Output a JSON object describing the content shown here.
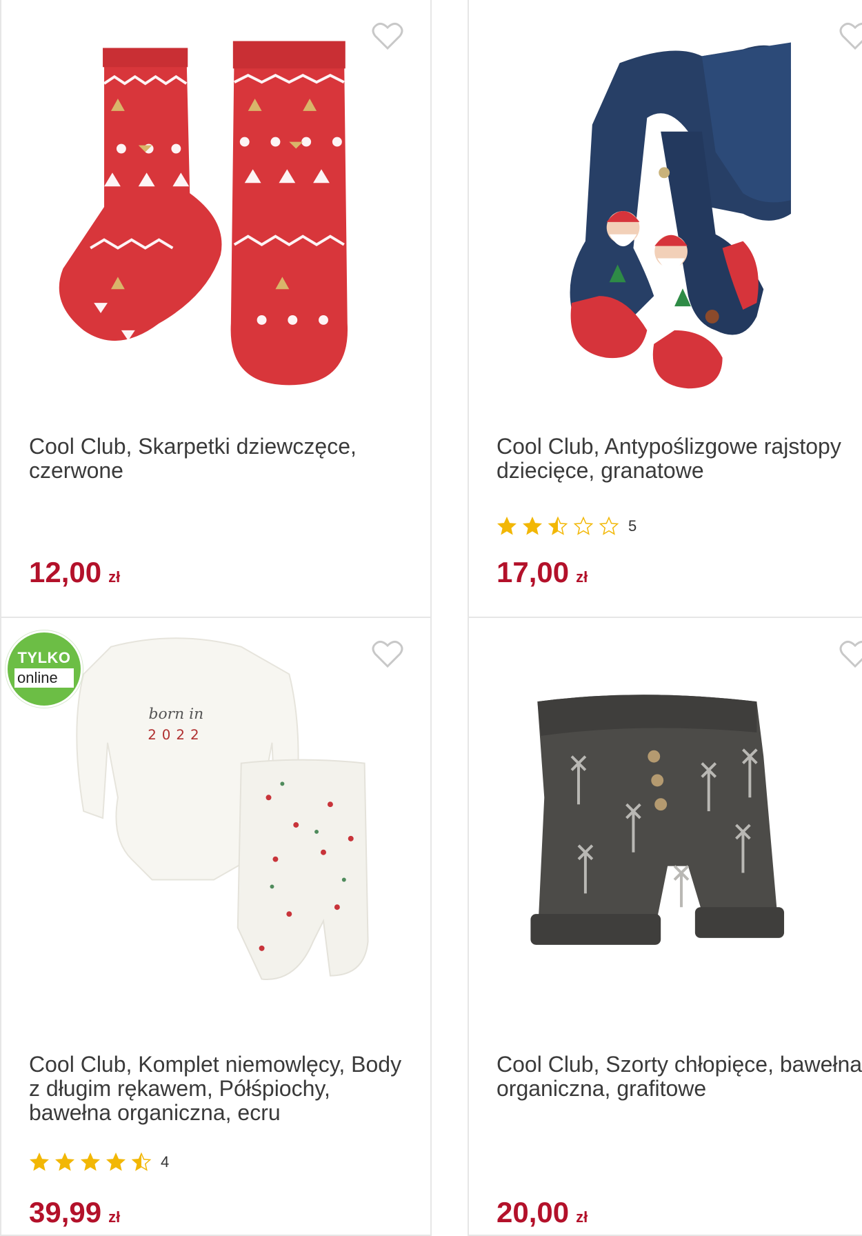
{
  "products": [
    {
      "title": "Cool Club, Skarpetki dziewczęce, czerwone",
      "price": "12,00",
      "currency": "zł",
      "rating": null,
      "review_count": null,
      "badge": null,
      "image": "red-christmas-socks"
    },
    {
      "title": "Cool Club, Antypoślizgowe rajstopy dziecięce, granatowe",
      "price": "17,00",
      "currency": "zł",
      "rating": 2.5,
      "review_count": "5",
      "badge": null,
      "image": "navy-santa-tights"
    },
    {
      "title": "Cool Club, Komplet niemowlęcy, Body z długim rękawem, Półśpiochy, bawełna organiczna, ecru",
      "price": "39,99",
      "currency": "zł",
      "rating": 4.5,
      "review_count": "4",
      "badge": {
        "line1": "TYLKO",
        "line2": "online"
      },
      "image": "ecru-baby-bodysuit-set",
      "image_text": {
        "script": "born in",
        "year": "2022"
      }
    },
    {
      "title": "Cool Club, Szorty chłopięce, bawełna organiczna, grafitowe",
      "price": "20,00",
      "currency": "zł",
      "rating": null,
      "review_count": null,
      "badge": null,
      "image": "graphite-palm-shorts"
    }
  ],
  "colors": {
    "price": "#b3112a",
    "star": "#f2b705",
    "badge": "#6cbe45"
  },
  "icons": {
    "favorite": "heart-outline-icon",
    "rating": "star-icon"
  }
}
